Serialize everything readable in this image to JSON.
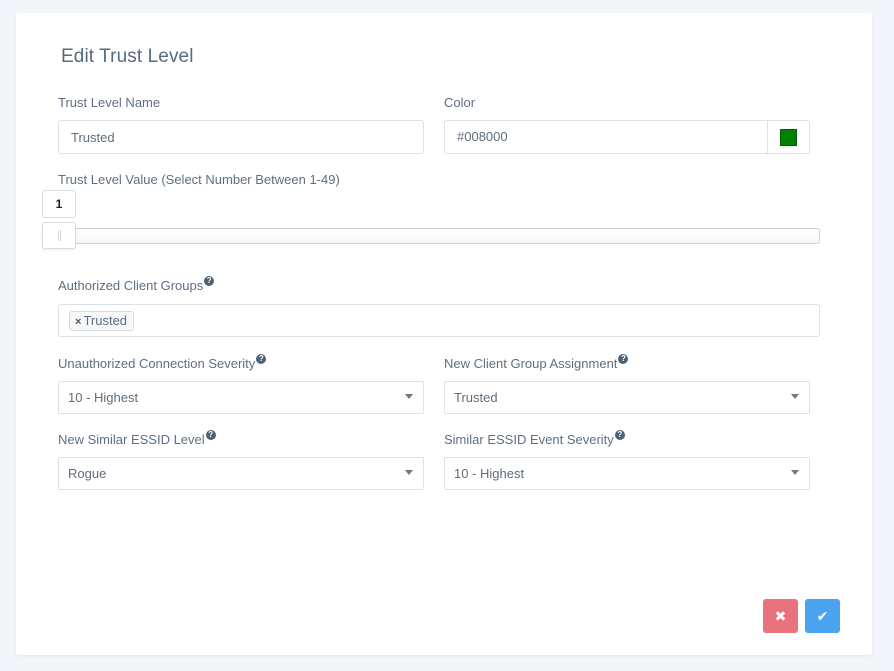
{
  "title": "Edit Trust Level",
  "fields": {
    "name_label": "Trust Level Name",
    "name_value": "Trusted",
    "color_label": "Color",
    "color_value": "#008000",
    "value_label": "Trust Level Value (Select Number Between 1-49)",
    "value_current": "1",
    "value_min": 1,
    "value_max": 49,
    "groups_label": "Authorized Client Groups",
    "groups_tags": [
      "Trusted"
    ],
    "tag_remove_glyph": "×",
    "unauth_label": "Unauthorized Connection Severity",
    "unauth_value": "10 - Highest",
    "newgroup_label": "New Client Group Assignment",
    "newgroup_value": "Trusted",
    "essid_level_label": "New Similar ESSID Level",
    "essid_level_value": "Rogue",
    "essid_sev_label": "Similar ESSID Event Severity",
    "essid_sev_value": "10 - Highest",
    "help_glyph": "?"
  },
  "buttons": {
    "cancel_glyph": "✖",
    "confirm_glyph": "✔"
  },
  "icons": {
    "help": "question-circle-icon",
    "cancel": "times-icon",
    "confirm": "check-icon",
    "dropdown": "caret-down-icon"
  },
  "colors": {
    "swatch": "#008000",
    "cancel_button": "#e8737d",
    "confirm_button": "#4aa3ef"
  }
}
